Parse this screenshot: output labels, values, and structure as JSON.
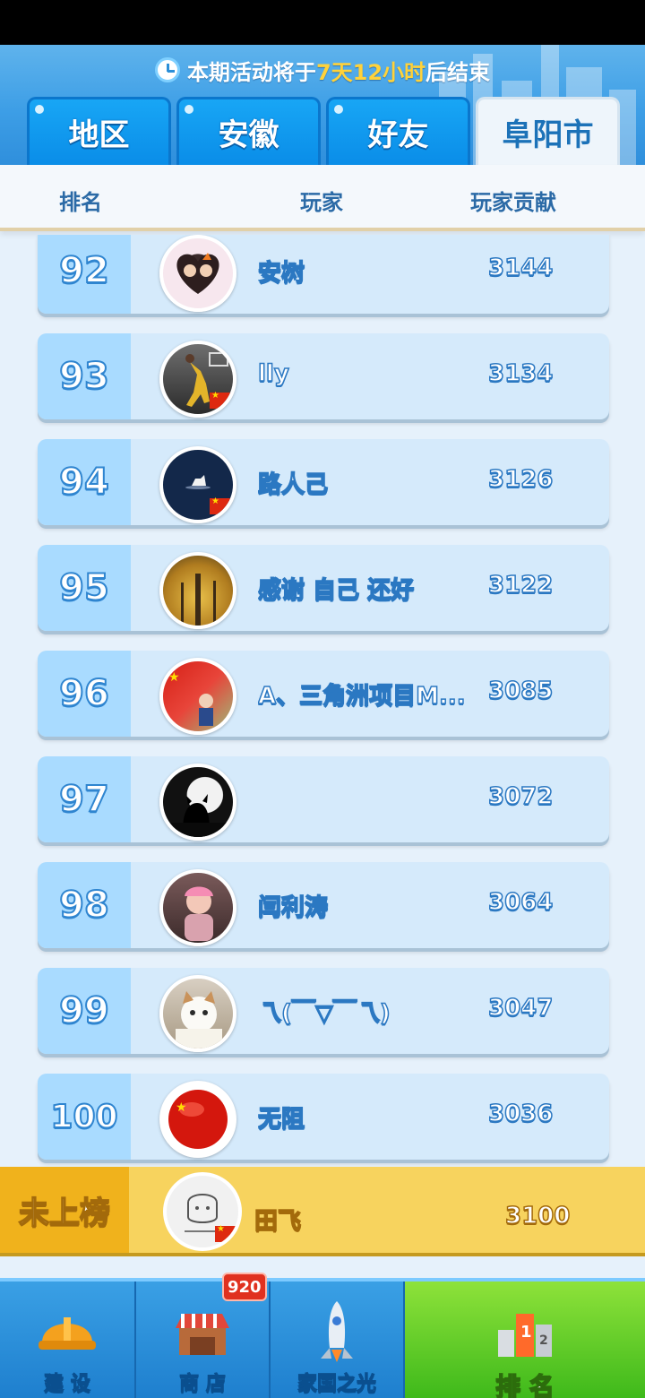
{
  "banner": {
    "prefix": "本期活动将于",
    "highlight": "7天12小时",
    "suffix": "后结束"
  },
  "tabs": [
    {
      "label": "地区",
      "active": false
    },
    {
      "label": "安徽",
      "active": false
    },
    {
      "label": "好友",
      "active": false
    },
    {
      "label": "阜阳市",
      "active": true
    }
  ],
  "columns": {
    "rank": "排名",
    "player": "玩家",
    "contribution": "玩家贡献"
  },
  "rows": [
    {
      "rank": "92",
      "name": "安树",
      "score": "3144"
    },
    {
      "rank": "93",
      "name": "lly",
      "score": "3134"
    },
    {
      "rank": "94",
      "name": "路人己",
      "score": "3126"
    },
    {
      "rank": "95",
      "name": "感谢 自己 还好",
      "score": "3122"
    },
    {
      "rank": "96",
      "name": "A、三角洲项目M...",
      "score": "3085"
    },
    {
      "rank": "97",
      "name": "",
      "score": "3072"
    },
    {
      "rank": "98",
      "name": "闫利涛",
      "score": "3064"
    },
    {
      "rank": "99",
      "name": "乁(￣▽￣乁)",
      "score": "3047"
    },
    {
      "rank": "100",
      "name": "无阻",
      "score": "3036"
    }
  ],
  "self_row": {
    "label": "未上榜",
    "name": "田飞",
    "score": "3100"
  },
  "bottom_nav": {
    "items": [
      {
        "label": "建 设",
        "icon": "hard-hat-icon",
        "active": false
      },
      {
        "label": "商 店",
        "icon": "shop-icon",
        "active": false
      },
      {
        "label": "家国之光",
        "icon": "rocket-icon",
        "active": false
      },
      {
        "label": "排 名",
        "icon": "ranking-tower-icon",
        "active": true
      }
    ],
    "shop_badge": "920"
  },
  "colors": {
    "tab_blue": "#0a8de8",
    "row_bg": "#d5eafb",
    "rank_bg": "#a9dbff",
    "self_row_bg": "#f7d35e",
    "highlight": "#ffd23a",
    "nav_active": "#3cb81a"
  }
}
